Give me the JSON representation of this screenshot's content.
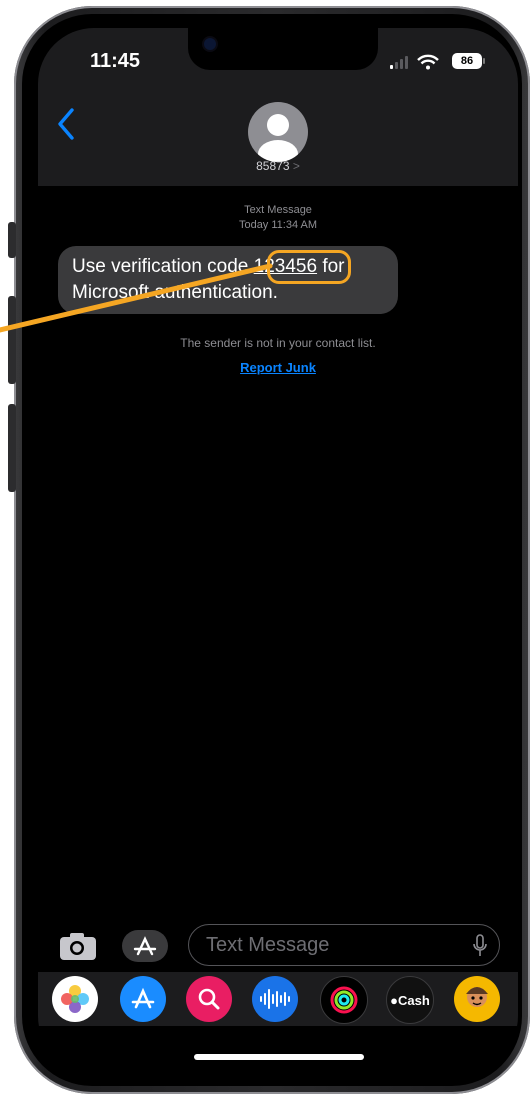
{
  "status_bar": {
    "time": "11:45",
    "battery": "86"
  },
  "header": {
    "sender": "85873",
    "sender_chevron": ">",
    "back_icon": "chevron-left-icon",
    "avatar_icon": "person-icon"
  },
  "thread": {
    "meta_type": "Text Message",
    "meta_time": "Today 11:34 AM",
    "message": {
      "line1_pre": "Use verification code ",
      "code": "123456",
      "line1_post": " for",
      "line2": "Microsoft authentication."
    },
    "sender_note": "The sender is not in your contact list.",
    "report_label": "Report Junk"
  },
  "composer": {
    "placeholder": "Text Message",
    "camera_icon": "camera-icon",
    "apps_icon": "app-store-icon",
    "mic_icon": "microphone-icon"
  },
  "app_tray": [
    {
      "name": "photos-app",
      "label": ""
    },
    {
      "name": "app-store-app",
      "label": ""
    },
    {
      "name": "web-images-app",
      "label": ""
    },
    {
      "name": "audio-message-app",
      "label": ""
    },
    {
      "name": "activity-app",
      "label": ""
    },
    {
      "name": "apple-cash-app",
      "label": "Cash"
    },
    {
      "name": "memoji-app",
      "label": ""
    }
  ],
  "colors": {
    "accent": "#0a84ff",
    "annotation": "#f5a623",
    "bubble": "#3a3a3c"
  }
}
